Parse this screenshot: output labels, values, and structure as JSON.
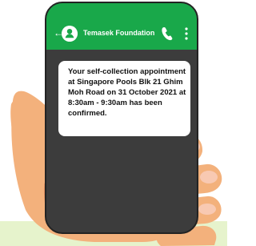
{
  "chat_header": {
    "back_glyph": "←",
    "contact_name": "Temasek Foundation",
    "avatar_icon": "person-icon",
    "call_icon": "phone-icon",
    "menu_icon": "more-vertical-icon"
  },
  "message": {
    "text": "Your self-collection appointment at Singapore Pools Blk 21 Ghim Moh Road on 31 October 2021 at 8:30am - 9:30am has been confirmed."
  },
  "colors": {
    "header_green": "#19a84a",
    "phone_body": "#3c3c3c",
    "bubble": "#ffffff",
    "skin": "#f3b17c",
    "skin_shadow": "#df8f61",
    "nail": "#f8c9b2",
    "bottom_strip": "#e6f3cc"
  }
}
